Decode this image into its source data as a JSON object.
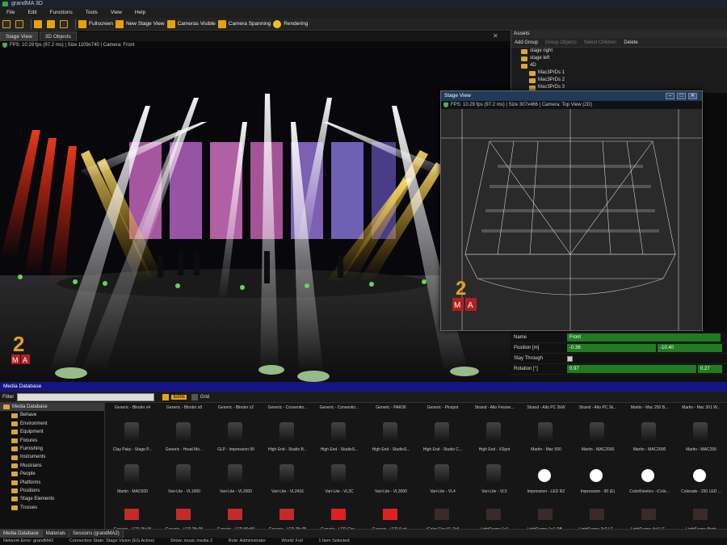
{
  "window": {
    "title": "grandMA 3D"
  },
  "menu": [
    "File",
    "Edit",
    "Functions",
    "Tools",
    "View",
    "Help"
  ],
  "toolbar": {
    "fullscreen": "Fullscreen",
    "new_stage_view": "New Stage View",
    "cameras_visible": "Cameras Visible",
    "camera_spanning": "Camera Spanning",
    "rendering": "Rendering"
  },
  "tabs": [
    "Stage View",
    "3D Objects"
  ],
  "stage_fps": "FPS: 10.29 fps (97.2 ms) | Size 1109x740 | Camera: Front",
  "assets": {
    "title": "Assets",
    "toolbar": [
      "Add Group",
      "Group Objects",
      "Select Children",
      "Delete"
    ],
    "tree": [
      "stage right",
      "stage left",
      "4D",
      "Mac3PrDs 1",
      "Mac3PrDs 2",
      "Mac3PrDs 3"
    ]
  },
  "top_view": {
    "title": "Stage View",
    "fps": "FPS: 10.29 fps (97.2 ms) | Size 307x466 | Camera: Top View (2D)",
    "buttons": [
      "–",
      "□",
      "✕"
    ]
  },
  "properties": {
    "name_label": "Name",
    "name_value": "Front",
    "position_label": "Position [m]",
    "position_values": [
      "-0.36",
      "-10.40"
    ],
    "stay_label": "Stay Through",
    "rotation_label": "Rotation [°]",
    "rotation_values": [
      "0.97",
      "0.27"
    ]
  },
  "media": {
    "title": "Media Database",
    "filter_label": "Filter",
    "view_icons": "Icons",
    "view_grid": "Grid",
    "tree": [
      "Media Database",
      "Behave",
      "Environment",
      "Equipment",
      "Fixtures",
      "Furnishing",
      "Instruments",
      "Musicians",
      "People",
      "Platforms",
      "Positions",
      "Stage Elements",
      "Trusses"
    ],
    "row1_headers": [
      "Generic - Blinder x4",
      "Generic - Blinder x8",
      "Generic - Blinder x2",
      "Generic - Conventio...",
      "Generic - Conventio...",
      "Generic - PAR36",
      "Generic - Pinspot",
      "Strand - Alto Fresne...",
      "Strand - Alto PC 2kW",
      "Strand - Alto PC 2k...",
      "Martin - Mac 250 B...",
      "Martin - Mac 301 W...",
      "Martin - Mac 250 E..."
    ],
    "row1": [
      "Clay Paky - Stage P...",
      "Generic - Head Mo...",
      "GLP - Impression 90",
      "High End - Studio B...",
      "High End - StudioS...",
      "High End - StudioS...",
      "High End - Studio C...",
      "High End - XSpot",
      "Martin - Mac 500",
      "Martin - MAC2000",
      "Martin - MAC2000",
      "Martin - MAC250",
      "Martin - MAC250"
    ],
    "row2": [
      "Martin - MAC600",
      "Vari-Lite - VL1000",
      "Vari-Lite - VL2000",
      "Vari-Lite - VL2416",
      "Vari-Lite - VL3C",
      "Vari-Lite - VL3000",
      "Vari-Lite - VL4",
      "Vari-Lite - VL5",
      "Impression - LED RZ",
      "Impression - 90 (E)",
      "ColorKinetics - iColo...",
      "Colorado - 250 LED ..."
    ],
    "row3": [
      "Generic - LED 15x15",
      "Generic - LED 25x25",
      "Generic - LED 50x50",
      "Generic - LED 75x75",
      "Generic - LED Circ...",
      "Generic - LED Surf...",
      "iColor Flex SL Tall",
      "LightFrame 1x1",
      "LightFrame 1x1 Off...",
      "LightFrame 2x2 LE...",
      "LightFrame 4x4 LE...",
      "LightFrame Body",
      "Colo..."
    ]
  },
  "bottom_tabs": [
    "Media Database",
    "Materials",
    "Sessions (grandMA2)"
  ],
  "status": [
    "Network Error: grandMA2",
    "Connection State: Stage Vision (EG Active)",
    "Show: music media 2",
    "Role: Administrator",
    "World: Full",
    "1 Item Selected"
  ]
}
